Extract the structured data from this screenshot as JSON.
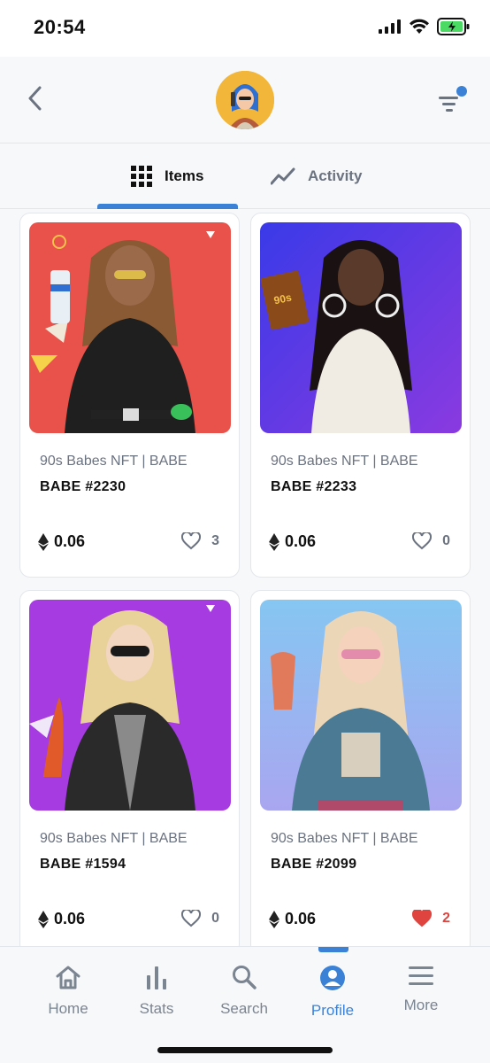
{
  "status_bar": {
    "time": "20:54"
  },
  "header": {
    "avatar_alt": "profile avatar"
  },
  "tabs": [
    {
      "label": "Items",
      "icon": "grid-icon",
      "active": true
    },
    {
      "label": "Activity",
      "icon": "activity-icon",
      "active": false
    }
  ],
  "items": [
    {
      "collection": "90s Babes NFT | BABE",
      "name": "BABE #2230",
      "price": "0.06",
      "likes": "3",
      "liked": false,
      "bg": "#e8524a"
    },
    {
      "collection": "90s Babes NFT | BABE",
      "name": "BABE #2233",
      "price": "0.06",
      "likes": "0",
      "liked": false,
      "bg": "#5b3be8"
    },
    {
      "collection": "90s Babes NFT | BABE",
      "name": "BABE #1594",
      "price": "0.06",
      "likes": "0",
      "liked": false,
      "bg": "#a53be0"
    },
    {
      "collection": "90s Babes NFT | BABE",
      "name": "BABE #2099",
      "price": "0.06",
      "likes": "2",
      "liked": true,
      "bg": "#8fc3f0"
    }
  ],
  "bottom_nav": [
    {
      "label": "Home",
      "icon": "home-icon",
      "active": false
    },
    {
      "label": "Stats",
      "icon": "stats-icon",
      "active": false
    },
    {
      "label": "Search",
      "icon": "search-icon",
      "active": false
    },
    {
      "label": "Profile",
      "icon": "profile-icon",
      "active": true
    },
    {
      "label": "More",
      "icon": "menu-icon",
      "active": false
    }
  ],
  "colors": {
    "accent": "#3b82d6",
    "liked": "#e0443e",
    "muted": "#6b7280"
  }
}
